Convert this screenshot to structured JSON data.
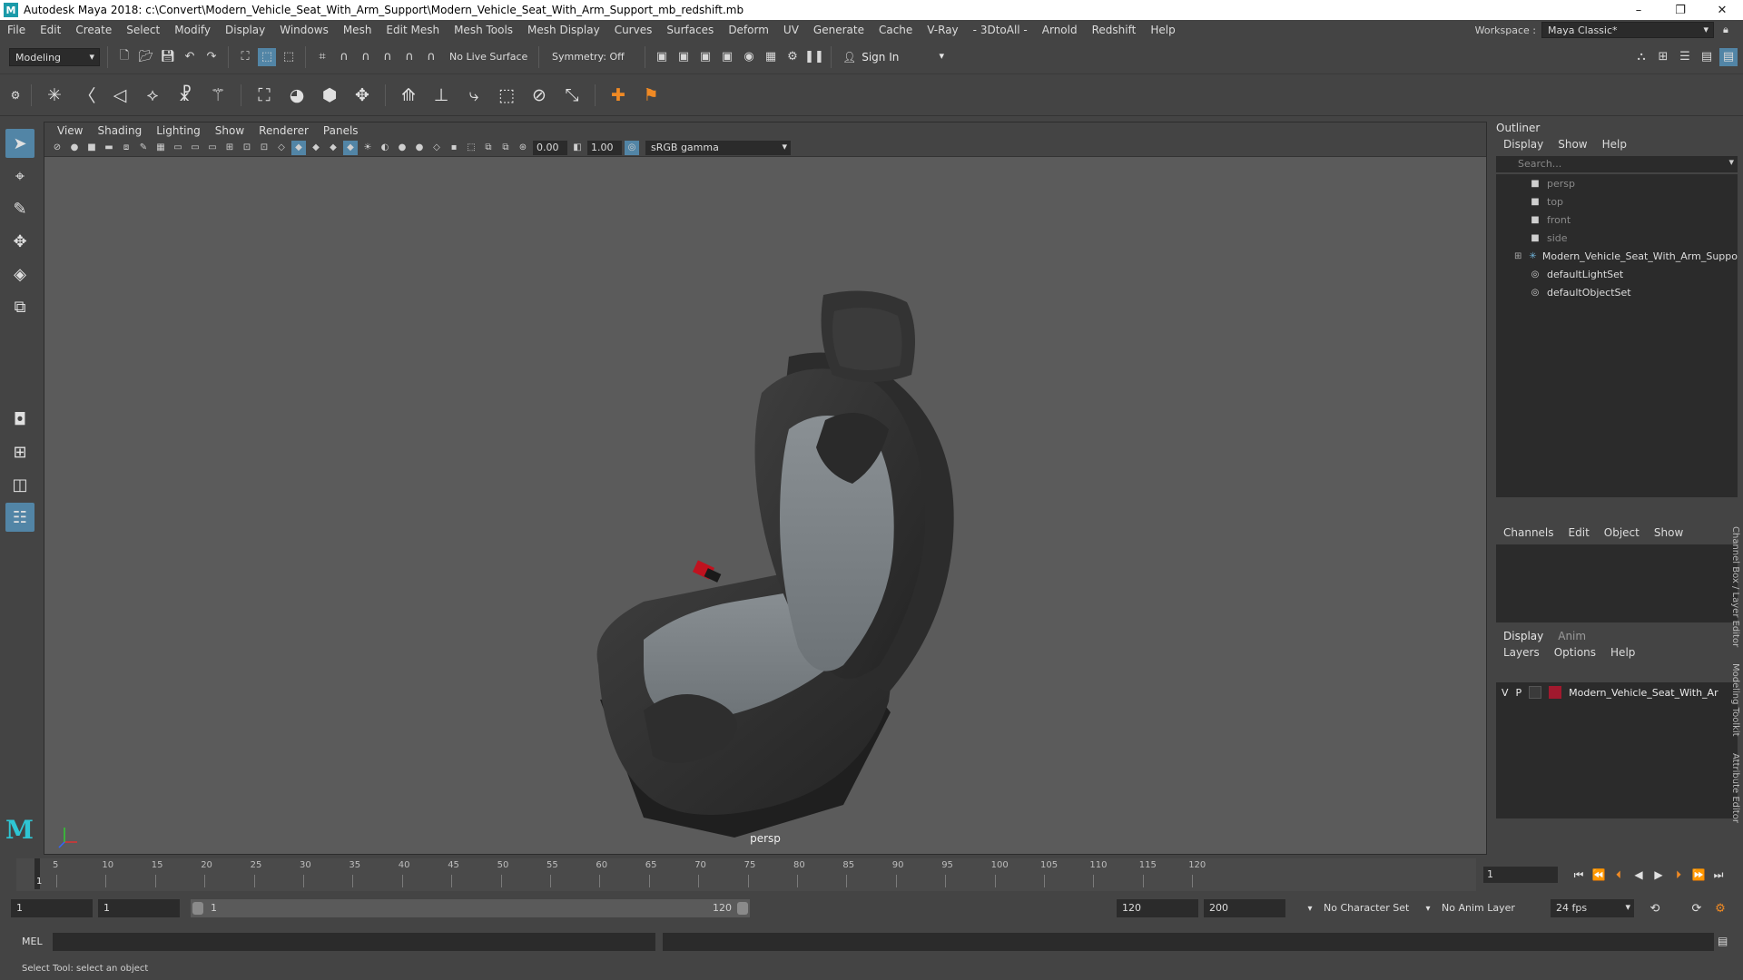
{
  "window": {
    "title": "Autodesk Maya 2018: c:\\Convert\\Modern_Vehicle_Seat_With_Arm_Support\\Modern_Vehicle_Seat_With_Arm_Support_mb_redshift.mb",
    "logo": "M",
    "minimize": "–",
    "restore": "❐",
    "close": "✕"
  },
  "menubar": {
    "items": [
      "File",
      "Edit",
      "Create",
      "Select",
      "Modify",
      "Display",
      "Windows",
      "Mesh",
      "Edit Mesh",
      "Mesh Tools",
      "Mesh Display",
      "Curves",
      "Surfaces",
      "Deform",
      "UV",
      "Generate",
      "Cache",
      "V-Ray",
      "- 3DtoAll -",
      "Arnold",
      "Redshift",
      "Help"
    ],
    "workspace_label": "Workspace :",
    "workspace_value": "Maya Classic*"
  },
  "statusline": {
    "mode": "Modeling",
    "live_surface": "No Live Surface",
    "symmetry": "Symmetry: Off",
    "sign_in": "Sign In"
  },
  "viewport": {
    "menus": [
      "View",
      "Shading",
      "Lighting",
      "Show",
      "Renderer",
      "Panels"
    ],
    "exposure": "0.00",
    "gamma": "1.00",
    "color_space": "sRGB gamma",
    "camera": "persp"
  },
  "outliner": {
    "title": "Outliner",
    "menus": [
      "Display",
      "Show",
      "Help"
    ],
    "search_placeholder": "Search...",
    "rows": [
      {
        "label": "persp",
        "icon": "camera-icon",
        "dim": true
      },
      {
        "label": "top",
        "icon": "camera-icon",
        "dim": true
      },
      {
        "label": "front",
        "icon": "camera-icon",
        "dim": true
      },
      {
        "label": "side",
        "icon": "camera-icon",
        "dim": true
      },
      {
        "label": "Modern_Vehicle_Seat_With_Arm_Suppo",
        "icon": "group-icon",
        "dim": false
      },
      {
        "label": "defaultLightSet",
        "icon": "set-icon",
        "dim": false
      },
      {
        "label": "defaultObjectSet",
        "icon": "set-icon",
        "dim": false
      }
    ]
  },
  "channel_box": {
    "menus": [
      "Channels",
      "Edit",
      "Object",
      "Show"
    ]
  },
  "layer_editor": {
    "tabs": [
      "Display",
      "Anim"
    ],
    "menus": [
      "Layers",
      "Options",
      "Help"
    ],
    "layer": {
      "v": "V",
      "p": "P",
      "name": "Modern_Vehicle_Seat_With_Ar",
      "color": "#a1192e"
    }
  },
  "side_tabs": [
    "Channel Box / Layer Editor",
    "Modeling Toolkit",
    "Attribute Editor"
  ],
  "timeline": {
    "ticks": [
      "5",
      "10",
      "15",
      "20",
      "25",
      "30",
      "35",
      "40",
      "45",
      "50",
      "55",
      "60",
      "65",
      "70",
      "75",
      "80",
      "85",
      "90",
      "95",
      "100",
      "105",
      "110",
      "115",
      "120"
    ],
    "current_frame": "1",
    "current_frame_field": "1"
  },
  "range": {
    "start": "1",
    "playback_start": "1",
    "slider_start": "1",
    "slider_end": "120",
    "playback_end": "120",
    "end": "200",
    "character_set": "No Character Set",
    "anim_layer": "No Anim Layer",
    "fps": "24 fps"
  },
  "cmdline": {
    "label": "MEL"
  },
  "helpline": {
    "text": "Select Tool: select an object"
  },
  "colors": {
    "accent": "#5285a6",
    "maya_teal": "#2ec5d3",
    "layer_red": "#a1192e"
  }
}
